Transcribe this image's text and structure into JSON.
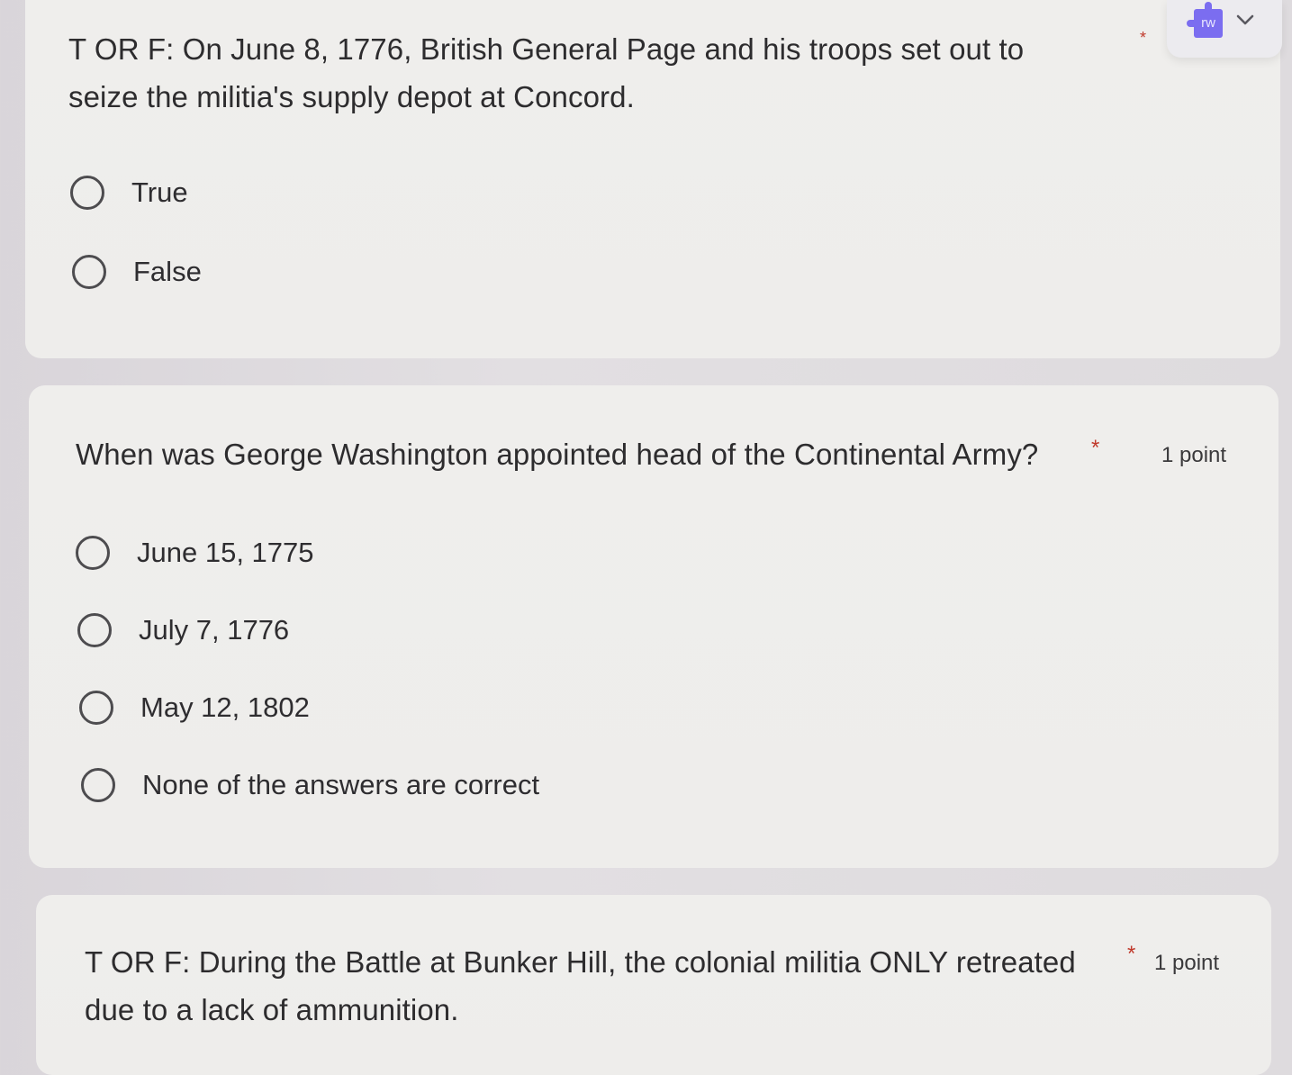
{
  "questions": [
    {
      "text_line1": "T OR F:  On June 8, 1776, British General Page and his troops set out to",
      "text_line2": "seize the militia's supply depot at Concord.",
      "required_mark": "*",
      "options": [
        "True",
        "False"
      ]
    },
    {
      "text": "When was George Washington appointed head of the Continental Army?",
      "required_mark": "*",
      "points": "1 point",
      "options": [
        "June 15, 1775",
        "July 7, 1776",
        "May 12, 1802",
        "None of the answers are correct"
      ]
    },
    {
      "text_line1": "T OR F: During the Battle at Bunker Hill, the colonial militia ONLY retreated",
      "text_line2": "due to a lack of ammunition.",
      "required_mark": "*",
      "points": "1 point"
    }
  ],
  "extension": {
    "logo_text": "rw",
    "icon": "chevron-down-icon",
    "accent_color": "#7b6df0"
  }
}
